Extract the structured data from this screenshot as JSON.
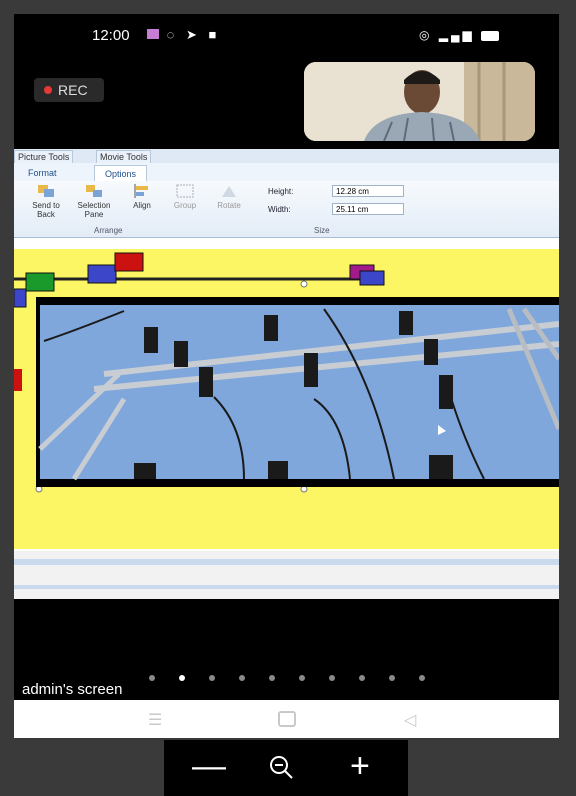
{
  "status_bar": {
    "time": "12:00"
  },
  "recording": {
    "label": "REC"
  },
  "shared_screen": {
    "ribbon": {
      "context_tabs": [
        "Picture Tools",
        "Movie Tools"
      ],
      "sub_tabs": [
        "Format",
        "Options"
      ],
      "buttons": [
        "Send to Back",
        "Selection Pane",
        "Align",
        "Group",
        "Rotate"
      ],
      "arrange_label": "Arrange",
      "size_label": "Size",
      "height_label": "Height:",
      "height_value": "12.28 cm",
      "width_label": "Width:",
      "width_value": "25.11 cm"
    }
  },
  "caption": "admin's screen",
  "page_indicator": {
    "count": 10,
    "active": 1
  },
  "zoom_controls": {
    "minus": "—",
    "plus": "+"
  },
  "colors": {
    "slide_bg": "#fdf664",
    "sky": "#7fa7dc",
    "rec_dot": "#e53935"
  }
}
